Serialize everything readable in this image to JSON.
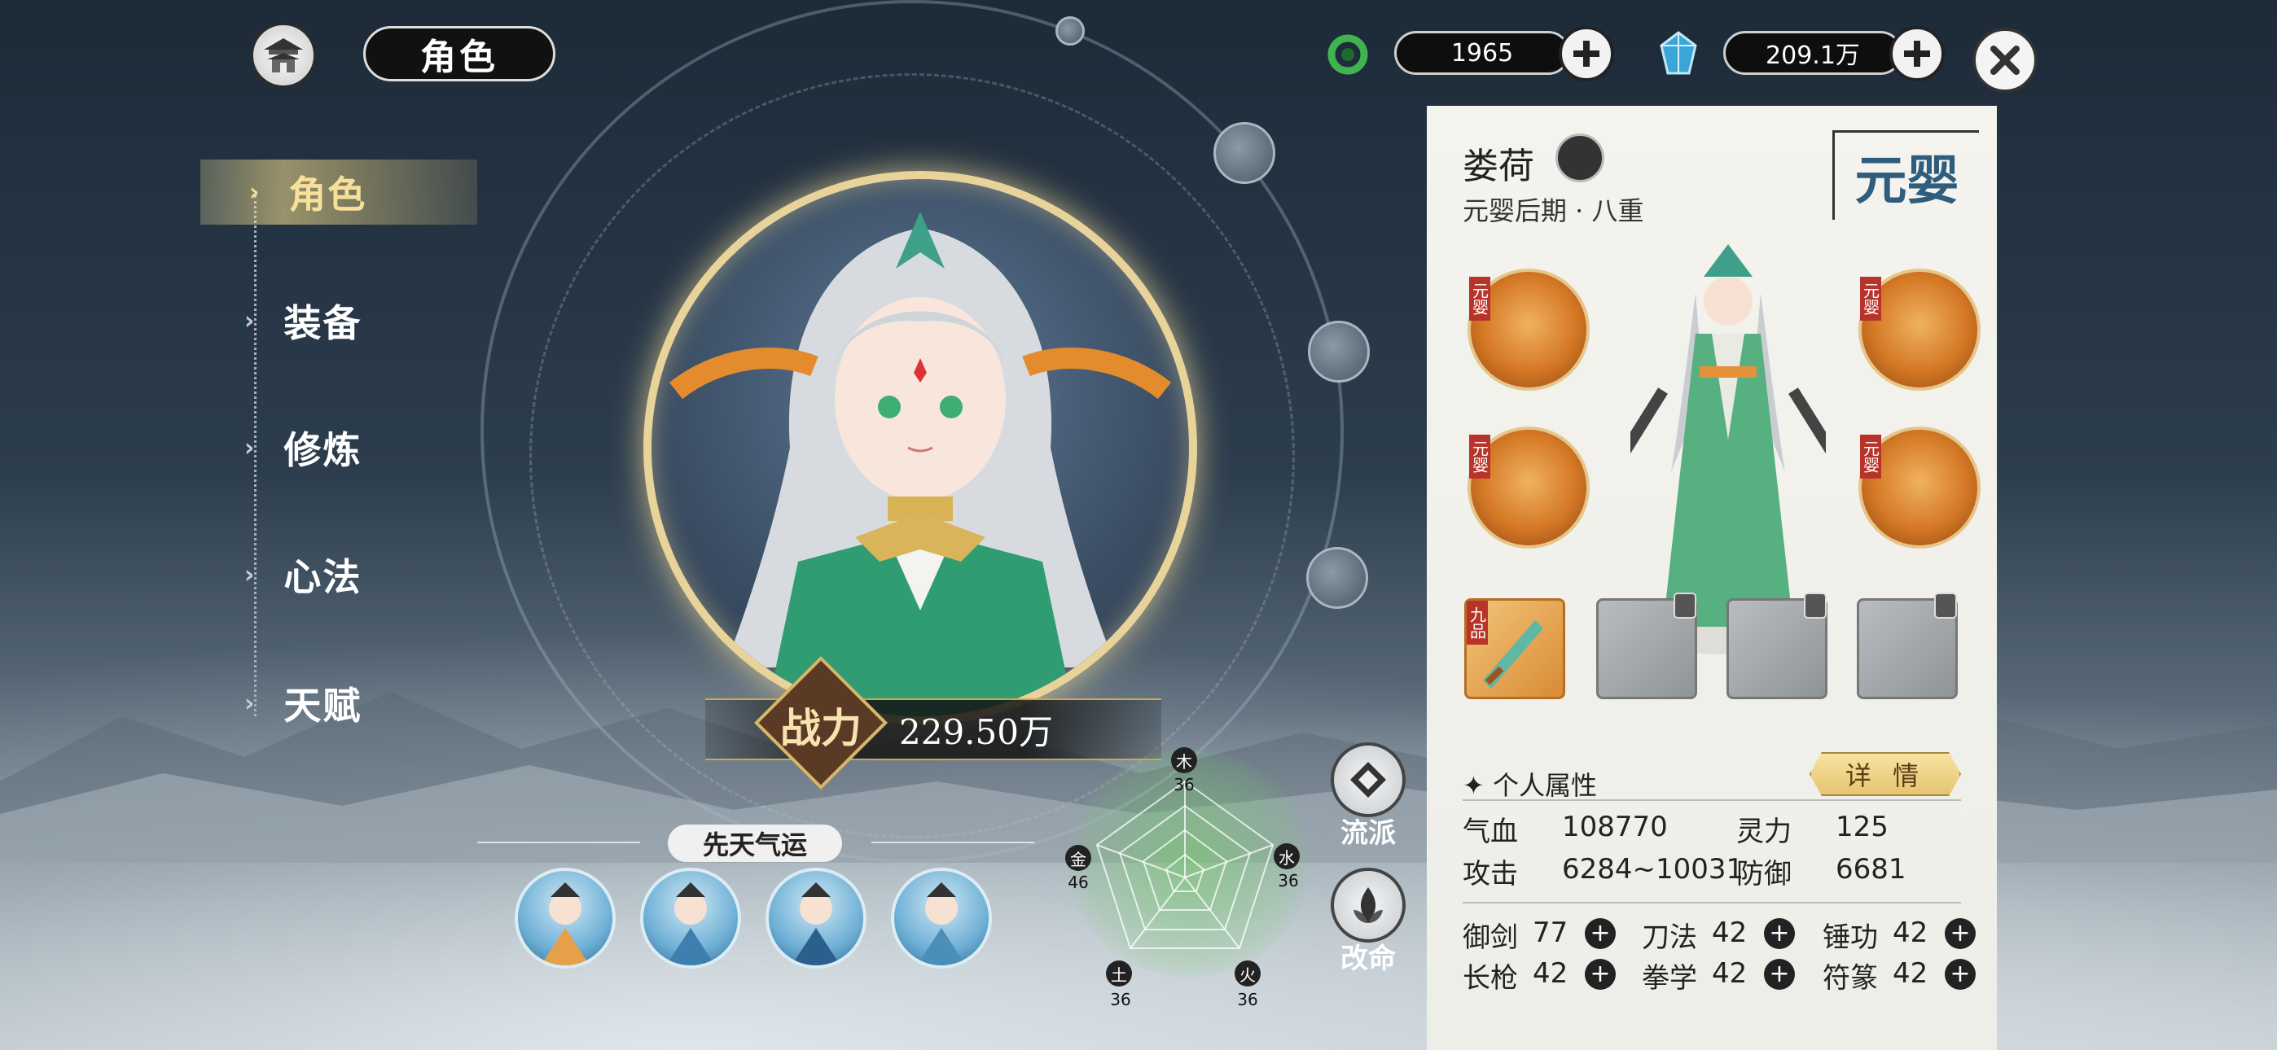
{
  "header": {
    "title": "角色",
    "currency1": {
      "icon": "jade-ring-icon",
      "value": "1965"
    },
    "currency2": {
      "icon": "spirit-crystal-icon",
      "value": "209.1万"
    }
  },
  "menu": {
    "items": [
      {
        "label": "角色",
        "active": true
      },
      {
        "label": "装备",
        "active": false
      },
      {
        "label": "修炼",
        "active": false
      },
      {
        "label": "心法",
        "active": false
      },
      {
        "label": "天赋",
        "active": false
      }
    ]
  },
  "portrait": {
    "power_label": "战力",
    "power_value": "229.50万"
  },
  "fortune": {
    "title": "先天气运"
  },
  "radar": {
    "elements": [
      {
        "name": "木",
        "value": "36"
      },
      {
        "name": "水",
        "value": "36"
      },
      {
        "name": "火",
        "value": "36"
      },
      {
        "name": "土",
        "value": "36"
      },
      {
        "name": "金",
        "value": "46"
      }
    ]
  },
  "actions": {
    "school": "流派",
    "fate": "改命"
  },
  "character": {
    "name": "娄荷",
    "realm_detail": "元婴后期 · 八重",
    "realm_seal": "元婴",
    "skill_tag": "元婴",
    "weapon_grade": "九品",
    "attr_title": "个人属性",
    "details": "详 情",
    "stats": [
      {
        "label": "气血",
        "value": "108770"
      },
      {
        "label": "灵力",
        "value": "125"
      },
      {
        "label": "攻击",
        "value": "6284~10031"
      },
      {
        "label": "防御",
        "value": "6681"
      }
    ],
    "skills": [
      {
        "label": "御剑",
        "value": "77"
      },
      {
        "label": "刀法",
        "value": "42"
      },
      {
        "label": "锤功",
        "value": "42"
      },
      {
        "label": "长枪",
        "value": "42"
      },
      {
        "label": "拳学",
        "value": "42"
      },
      {
        "label": "符篆",
        "value": "42"
      }
    ]
  }
}
